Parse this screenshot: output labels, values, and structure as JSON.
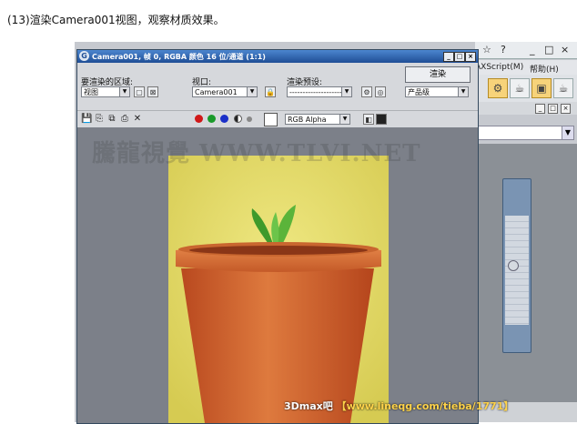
{
  "caption": "(13)渲染Camera001视图，观察材质效果。",
  "render_window": {
    "title": "Camera001, 帧 0, RGBA 颜色 16 位/通道 (1:1)",
    "title_buttons": [
      "_",
      "□",
      "×"
    ],
    "area_label": "要渲染的区域:",
    "area_value": "视图",
    "viewport_label": "视口:",
    "viewport_value": "Camera001",
    "preset_label": "渲染预设:",
    "preset_value": "----------------------",
    "render_button": "渲染",
    "quality_value": "产品级",
    "channel_value": "RGB Alpha"
  },
  "watermark": "騰龍視覺 WWW.TLVI.NET",
  "footer_watermark": {
    "part1": "3Dmax吧",
    "part2": "【www.lineqg.com/tieba/1771】"
  },
  "app": {
    "menu_items": [
      "AXScript(M)",
      "帮助(H)"
    ],
    "top_icons": [
      "☆",
      "?"
    ]
  },
  "colors": {
    "title_bar": "#1f4e96",
    "pot": "#d2612e",
    "background_render": "#e6dd6c",
    "leaf": "#47a032"
  }
}
